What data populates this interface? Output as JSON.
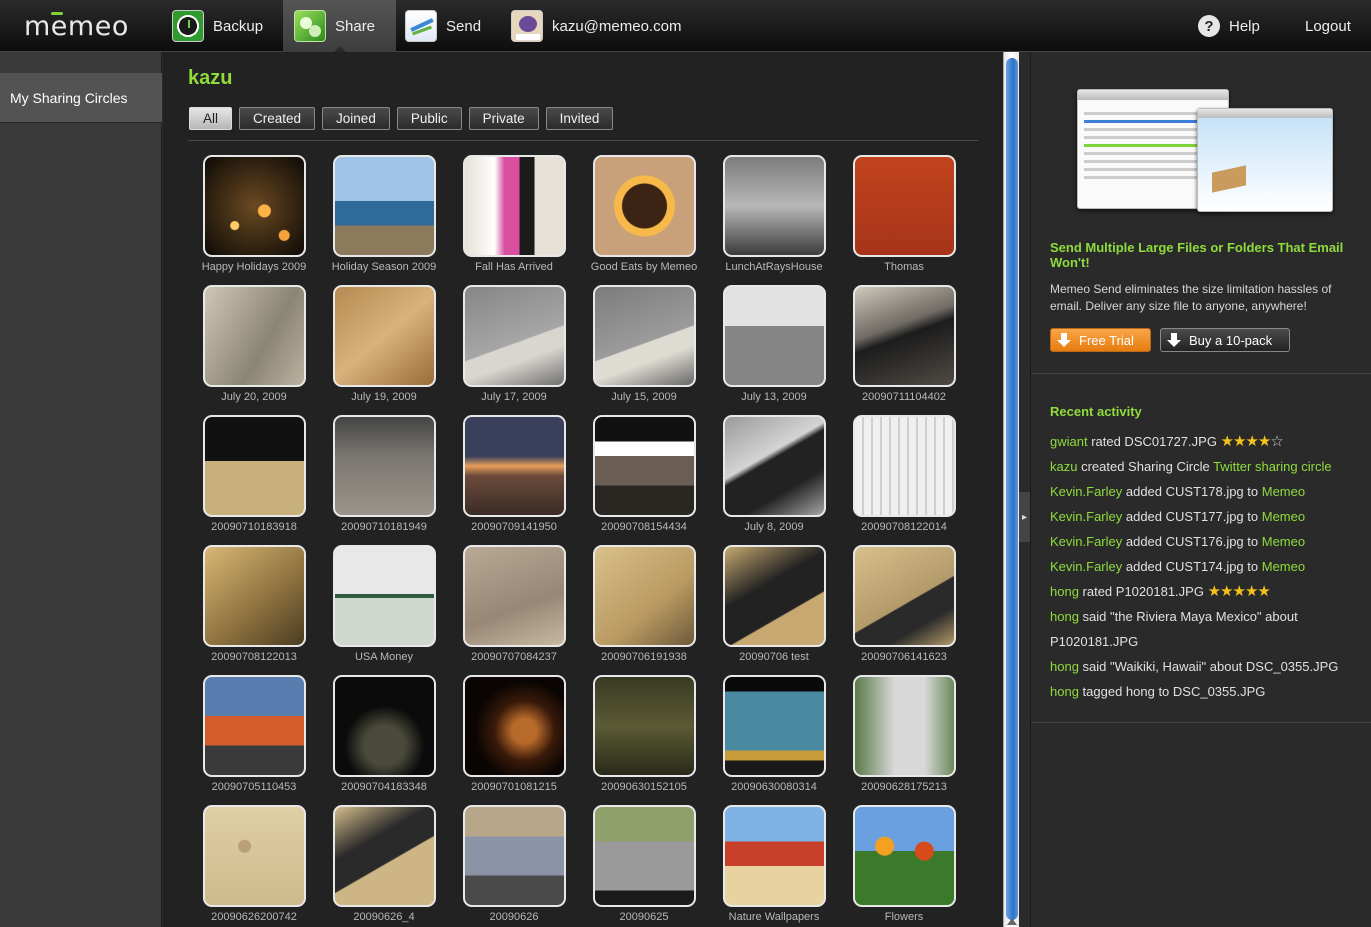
{
  "header": {
    "logo": "memeo",
    "nav": [
      {
        "label": "Backup",
        "icon": "backup-clock-icon"
      },
      {
        "label": "Share",
        "icon": "share-circles-icon",
        "active": true
      },
      {
        "label": "Send",
        "icon": "send-plane-icon"
      },
      {
        "label": "kazu@memeo.com",
        "icon": "user-avatar-icon"
      }
    ],
    "help_label": "Help",
    "help_glyph": "?",
    "logout_label": "Logout"
  },
  "sidebar": {
    "items": [
      {
        "label": "My Sharing Circles",
        "active": true
      }
    ]
  },
  "main": {
    "owner": "kazu",
    "filters": [
      {
        "label": "All",
        "active": true
      },
      {
        "label": "Created"
      },
      {
        "label": "Joined"
      },
      {
        "label": "Public"
      },
      {
        "label": "Private"
      },
      {
        "label": "Invited"
      }
    ],
    "circles": [
      {
        "caption": "Happy Holidays 2009"
      },
      {
        "caption": "Holiday Season 2009"
      },
      {
        "caption": "Fall Has Arrived"
      },
      {
        "caption": "Good Eats by Memeo"
      },
      {
        "caption": "LunchAtRaysHouse"
      },
      {
        "caption": "Thomas"
      },
      {
        "caption": "July 20, 2009"
      },
      {
        "caption": "July 19, 2009"
      },
      {
        "caption": "July 17, 2009"
      },
      {
        "caption": "July 15, 2009"
      },
      {
        "caption": "July 13, 2009"
      },
      {
        "caption": "20090711104402"
      },
      {
        "caption": "20090710183918"
      },
      {
        "caption": "20090710181949"
      },
      {
        "caption": "20090709141950"
      },
      {
        "caption": "20090708154434"
      },
      {
        "caption": "July 8, 2009"
      },
      {
        "caption": "20090708122014"
      },
      {
        "caption": "20090708122013"
      },
      {
        "caption": "USA Money"
      },
      {
        "caption": "20090707084237"
      },
      {
        "caption": "20090706191938"
      },
      {
        "caption": "20090706 test"
      },
      {
        "caption": "20090706141623"
      },
      {
        "caption": "20090705110453"
      },
      {
        "caption": "20090704183348"
      },
      {
        "caption": "20090701081215"
      },
      {
        "caption": "20090630152105"
      },
      {
        "caption": "20090630080314"
      },
      {
        "caption": "20090628175213"
      },
      {
        "caption": "20090626200742"
      },
      {
        "caption": "20090626_4"
      },
      {
        "caption": "20090626"
      },
      {
        "caption": "20090625"
      },
      {
        "caption": "Nature Wallpapers"
      },
      {
        "caption": "Flowers"
      }
    ]
  },
  "promo": {
    "title": "Send Multiple Large Files or Folders That Email Won't!",
    "text": "Memeo Send eliminates the size limitation hassles of email. Deliver any size file to anyone, anywhere!",
    "trial_label": "Free Trial",
    "pack_label": "Buy a 10-pack"
  },
  "activity": {
    "title": "Recent activity",
    "items": [
      {
        "user": "gwiant",
        "text": " rated DSC01727.JPG ",
        "stars": 4
      },
      {
        "user": "kazu",
        "text": " created Sharing Circle ",
        "link": "Twitter sharing circle"
      },
      {
        "user": "Kevin.Farley",
        "text": " added CUST178.jpg to ",
        "link": "Memeo"
      },
      {
        "user": "Kevin.Farley",
        "text": " added CUST177.jpg to ",
        "link": "Memeo"
      },
      {
        "user": "Kevin.Farley",
        "text": " added CUST176.jpg to ",
        "link": "Memeo"
      },
      {
        "user": "Kevin.Farley",
        "text": " added CUST174.jpg to ",
        "link": "Memeo"
      },
      {
        "user": "hong",
        "text": " rated P1020181.JPG ",
        "stars": 5
      },
      {
        "user": "hong",
        "text": " said \"the Riviera Maya Mexico\" about"
      },
      {
        "user": "",
        "text": "P1020181.JPG"
      },
      {
        "user": "hong",
        "text": " said \"Waikiki, Hawaii\" about DSC_0355.JPG"
      },
      {
        "user": "hong",
        "text": " tagged hong to DSC_0355.JPG"
      }
    ]
  },
  "colors": {
    "accent_green": "#8fdc3c",
    "trial_orange": "#f39a34",
    "scroll_blue": "#2f72c7"
  }
}
